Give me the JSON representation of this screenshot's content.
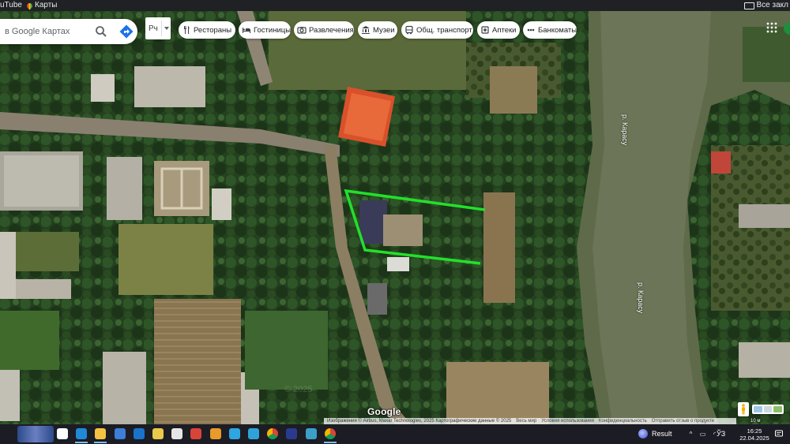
{
  "bookmarks": {
    "youtube_label": "uTube",
    "maps_label": "Карты",
    "all_bookmarks_label": "Все закл"
  },
  "search": {
    "placeholder": "Поиск на Google Картах",
    "visible_text": "в Google Картах"
  },
  "language_selector": {
    "label": "Рч"
  },
  "chips": [
    {
      "label": "Рестораны",
      "icon": "fork-knife-icon"
    },
    {
      "label": "Гостиницы",
      "icon": "bed-icon"
    },
    {
      "label": "Развлечения",
      "icon": "camera-icon"
    },
    {
      "label": "Музеи",
      "icon": "museum-icon"
    },
    {
      "label": "Общ. транспорт",
      "icon": "bus-icon"
    },
    {
      "label": "Аптеки",
      "icon": "pharmacy-icon"
    },
    {
      "label": "Банкоматы",
      "icon": "atm-icon"
    }
  ],
  "map": {
    "river_label": "р. Карасу",
    "google_logo": "Google",
    "watermark": "© 2025",
    "highlight_color": "#22e02a",
    "attribution": {
      "imagery": "Изображения © Airbus, Maxar Technologies, 2025 Картографические данные © 2025",
      "all_map": "Весь мир",
      "terms": "Условия использования",
      "privacy": "Конфиденциальность",
      "feedback": "Отправить отзыв о продукте"
    },
    "scale_label": "10 м"
  },
  "taskbar": {
    "result_label": "Result",
    "language": "ЎЗ",
    "time": "16:25",
    "date": "22.04.2025",
    "apps": [
      {
        "name": "task-view",
        "color": "#ffffff"
      },
      {
        "name": "edge",
        "color": "#1f8ad6"
      },
      {
        "name": "file-explorer",
        "color": "#f5c242"
      },
      {
        "name": "store",
        "color": "#3d7fd6"
      },
      {
        "name": "outlook",
        "color": "#1a73c9"
      },
      {
        "name": "wand-app",
        "color": "#e8c94a"
      },
      {
        "name": "notepad",
        "color": "#e6e6e6"
      },
      {
        "name": "red-app",
        "color": "#d9443a"
      },
      {
        "name": "paint-app",
        "color": "#e89a2a"
      },
      {
        "name": "telegram",
        "color": "#2ea6e0"
      },
      {
        "name": "blue-app",
        "color": "#2fa3d9"
      },
      {
        "name": "chrome",
        "color": "#db4437"
      },
      {
        "name": "photoshop",
        "color": "#2a3b8f"
      },
      {
        "name": "globe-app",
        "color": "#3aa0c9"
      },
      {
        "name": "chrome-active",
        "color": "#db4437"
      }
    ]
  }
}
